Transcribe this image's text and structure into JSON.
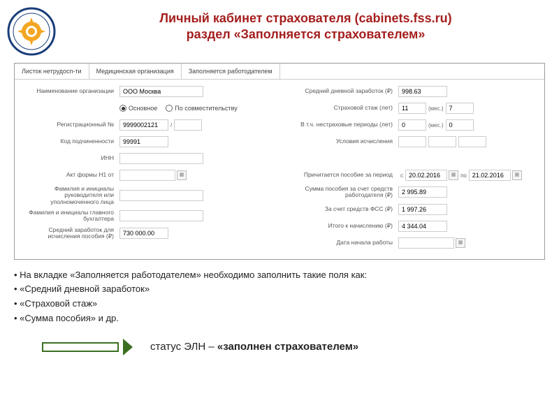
{
  "header": {
    "title_line1": "Личный кабинет страхователя (cabinets.fss.ru)",
    "title_line2": "раздел «Заполняется страхователем»"
  },
  "tabs": {
    "t1": "Листок нетрудосп-ти",
    "t2": "Медицинская организация",
    "t3": "Заполняется работодателем"
  },
  "left": {
    "org_label": "Наименование организации",
    "org_value": "ООО Москва",
    "radio_main": "Основное",
    "radio_sec": "По совместительству",
    "reg_label": "Регистрационный №",
    "reg_value": "9999002121",
    "slash": "/",
    "code_label": "Код подчиненности",
    "code_value": "99991",
    "inn_label": "ИНН",
    "akt_label": "Акт формы Н1 от",
    "fio_label": "Фамилия и инициалы руководителя или уполномоченного лица",
    "buh_label": "Фамилия и инициалы главного бухгалтера",
    "avg_label": "Средний заработок для исчисления пособия (₽)",
    "avg_value": "730 000.00"
  },
  "right": {
    "daily_label": "Средний дневной заработок (₽)",
    "daily_value": "998.63",
    "stazh_label": "Страховой стаж (лет)",
    "stazh_years": "11",
    "mes": "(мес.)",
    "stazh_months": "7",
    "nonins_label": "В т.ч. нестраховые периоды (лет)",
    "nonins_years": "0",
    "nonins_months": "0",
    "cond_label": "Условия исчисления",
    "benefit_label": "Причитается пособие за период",
    "date_from_lbl": "с",
    "date_from": "20.02.2016",
    "date_to_lbl": "по",
    "date_to": "21.02.2016",
    "sum_emp_label": "Сумма пособия за счет средств работодателя (₽)",
    "sum_emp_value": "2 995.89",
    "sum_fss_label": "За счет средств ФСС (₽)",
    "sum_fss_value": "1 997.26",
    "total_label": "Итого к начислению (₽)",
    "total_value": "4 344.04",
    "start_label": "Дата начала работы"
  },
  "bullets": {
    "b1": "На вкладке «Заполняется работодателем» необходимо заполнить такие поля как:",
    "b2": "«Средний дневной заработок»",
    "b3": "«Страховой стаж»",
    "b4": "«Сумма пособия» и др."
  },
  "status": {
    "prefix": "статус ЭЛН – ",
    "value": "«заполнен страхователем»"
  }
}
